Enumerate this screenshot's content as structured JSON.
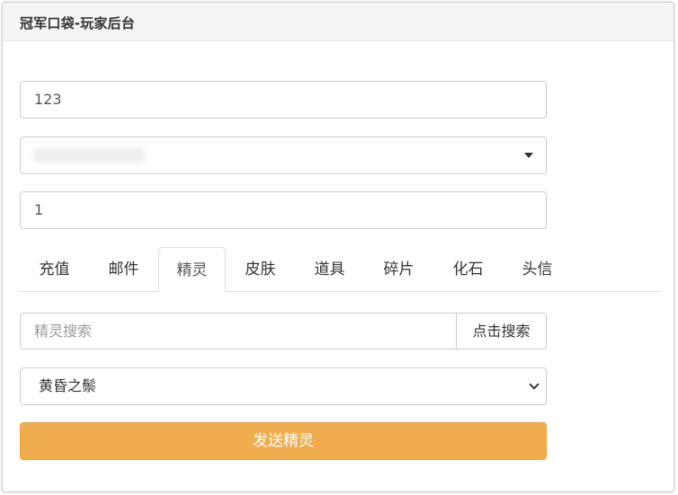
{
  "panel": {
    "title": "冠军口袋-玩家后台"
  },
  "form": {
    "player_id": "123",
    "server_select_value": "",
    "quantity": "1"
  },
  "tabs": [
    {
      "label": "充值"
    },
    {
      "label": "邮件"
    },
    {
      "label": "精灵",
      "active": true
    },
    {
      "label": "皮肤"
    },
    {
      "label": "道具"
    },
    {
      "label": "碎片"
    },
    {
      "label": "化石"
    },
    {
      "label": "头信"
    }
  ],
  "search": {
    "placeholder": "精灵搜索",
    "button_label": "点击搜索"
  },
  "sprite_select": {
    "selected": "黄昏之鬃"
  },
  "send_button": {
    "label": "发送精灵"
  },
  "colors": {
    "header_bg": "#f5f5f5",
    "warning_button": "#f0ad4e",
    "border": "#cccccc"
  }
}
